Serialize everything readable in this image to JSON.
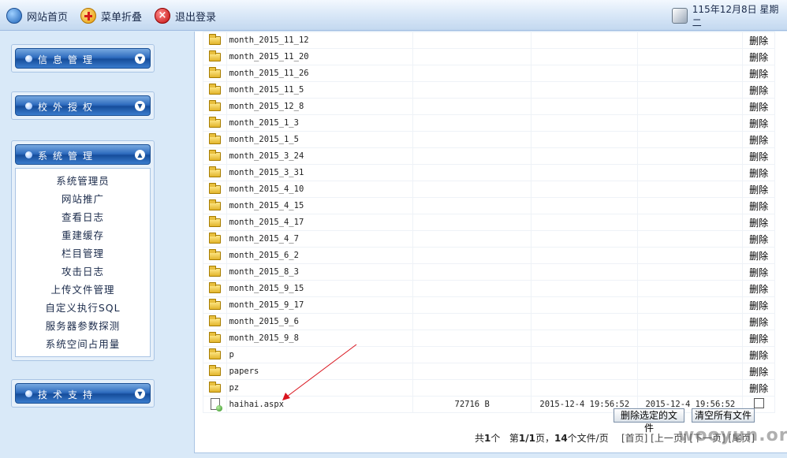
{
  "topbar": {
    "home_label": "网站首页",
    "menu_label": "菜单折叠",
    "logout_label": "退出登录",
    "date_text": "115年12月8日 星期二"
  },
  "sidebar": {
    "info_title": "信息管理",
    "auth_title": "校外授权",
    "system_title": "系统管理",
    "support_title": "技术支持",
    "system_items": [
      "系统管理员",
      "网站推广",
      "查看日志",
      "重建缓存",
      "栏目管理",
      "攻击日志",
      "上传文件管理",
      "自定义执行SQL",
      "服务器参数探测",
      "系统空间占用量"
    ]
  },
  "files": {
    "action_label": "删除",
    "folders": [
      "month_2015_11_12",
      "month_2015_11_20",
      "month_2015_11_26",
      "month_2015_11_5",
      "month_2015_12_8",
      "month_2015_1_3",
      "month_2015_1_5",
      "month_2015_3_24",
      "month_2015_3_31",
      "month_2015_4_10",
      "month_2015_4_15",
      "month_2015_4_17",
      "month_2015_4_7",
      "month_2015_6_2",
      "month_2015_8_3",
      "month_2015_9_15",
      "month_2015_9_17",
      "month_2015_9_6",
      "month_2015_9_8",
      "p",
      "papers",
      "pz"
    ],
    "file": {
      "name": "haihai.aspx",
      "size": "72716 B",
      "created": "2015-12-4 19:56:52",
      "modified": "2015-12-4 19:56:52"
    }
  },
  "buttons": {
    "delete_selected": "删除选定的文件",
    "clear_all": "清空所有文件"
  },
  "pager": {
    "total_prefix": "共",
    "total_count": "1",
    "total_suffix": "个",
    "page_prefix": "第",
    "page_value": "1/1",
    "page_suffix": "页，",
    "per_page_value": "14",
    "per_page_suffix": "个文件/页",
    "extra": "[首页] [上一页] [下一页] [尾页]"
  },
  "watermark": "wooyun.org",
  "colors": {
    "accent": "#2f6dbf",
    "background": "#d9e9f8",
    "arrow": "#d9141e"
  }
}
